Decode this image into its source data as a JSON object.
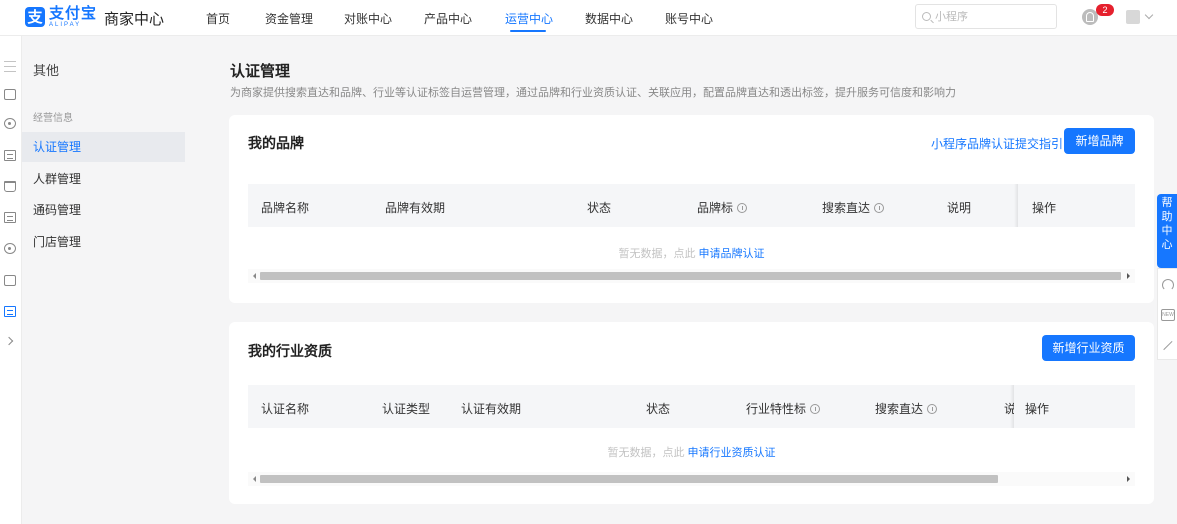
{
  "brand": {
    "logo_glyph": "支",
    "logo_cn": "支付宝",
    "logo_en": "ALIPAY",
    "app_name": "商家中心",
    "accent_color": "#1677ff"
  },
  "nav": {
    "items": [
      {
        "label": "首页"
      },
      {
        "label": "资金管理"
      },
      {
        "label": "对账中心"
      },
      {
        "label": "产品中心"
      },
      {
        "label": "运营中心"
      },
      {
        "label": "数据中心"
      },
      {
        "label": "账号中心"
      }
    ],
    "active": "运营中心"
  },
  "search": {
    "placeholder": "小程序",
    "value": ""
  },
  "notifications": {
    "count": "2"
  },
  "rail_icons": [
    "menu-icon",
    "box-icon",
    "target-icon",
    "calendar-icon",
    "bag-icon",
    "document-icon",
    "coin-icon",
    "camera-icon",
    "document-active-icon",
    "chevron-right-icon"
  ],
  "sidebar": {
    "title": "其他",
    "group_label": "经营信息",
    "items": [
      {
        "label": "认证管理",
        "active": true
      },
      {
        "label": "人群管理",
        "active": false
      },
      {
        "label": "通码管理",
        "active": false
      },
      {
        "label": "门店管理",
        "active": false
      }
    ]
  },
  "page": {
    "title": "认证管理",
    "description": "为商家提供搜索直达和品牌、行业等认证标签自运营管理，通过品牌和行业资质认证、关联应用，配置品牌直达和透出标签，提升服务可信度和影响力"
  },
  "brands": {
    "title": "我的品牌",
    "guide_link": "小程序品牌认证提交指引",
    "add_button": "新增品牌",
    "columns": [
      "品牌名称",
      "品牌有效期",
      "状态",
      "品牌标",
      "搜索直达",
      "说明",
      "操作"
    ],
    "empty_text": "暂无数据，点此",
    "empty_link": "申请品牌认证"
  },
  "industry": {
    "title": "我的行业资质",
    "add_button": "新增行业资质",
    "columns": [
      "认证名称",
      "认证类型",
      "认证有效期",
      "状态",
      "行业特性标",
      "搜索直达",
      "说",
      "操作"
    ],
    "empty_text": "暂无数据，点此",
    "empty_link": "申请行业资质认证"
  },
  "help": {
    "tab_chars": [
      "帮",
      "助",
      "中",
      "心"
    ],
    "new_label": "NEW"
  }
}
